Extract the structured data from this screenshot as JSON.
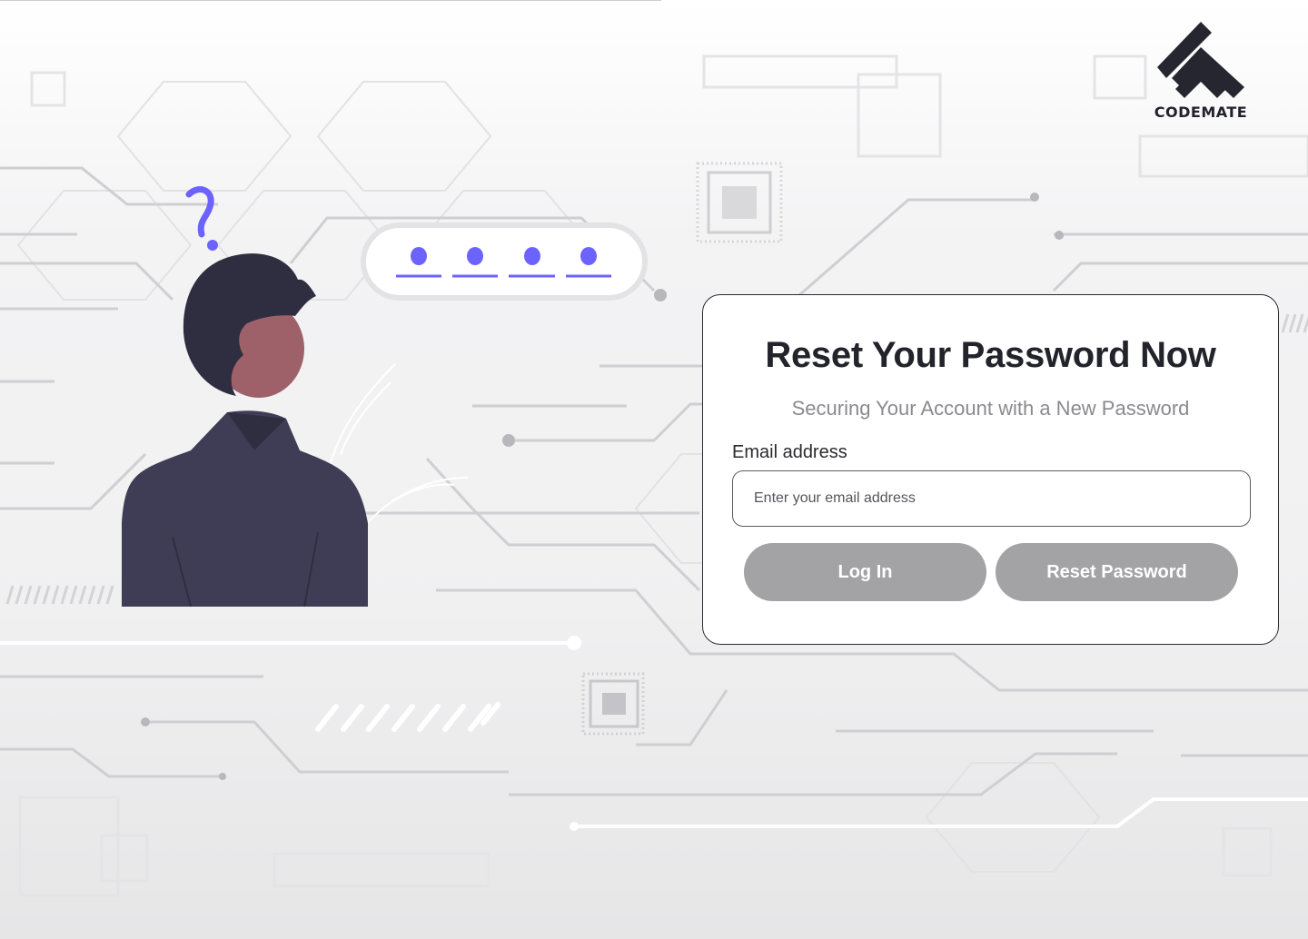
{
  "brand": {
    "name": "CODEMATE",
    "mark_color": "#262630"
  },
  "illustration": {
    "question_mark": "?",
    "password_dot_count": 4,
    "accent_color": "#6c63ff",
    "suit_color": "#3f3d56",
    "hair_color": "#2f2e41",
    "skin_color": "#9e616a"
  },
  "card": {
    "title": "Reset Your Password Now",
    "subtitle": "Securing Your Account with a New Password",
    "email": {
      "label": "Email address",
      "placeholder": "Enter your email address",
      "value": ""
    },
    "buttons": {
      "login_label": "Log In",
      "reset_label": "Reset Password",
      "color": "#a3a3a5"
    }
  }
}
